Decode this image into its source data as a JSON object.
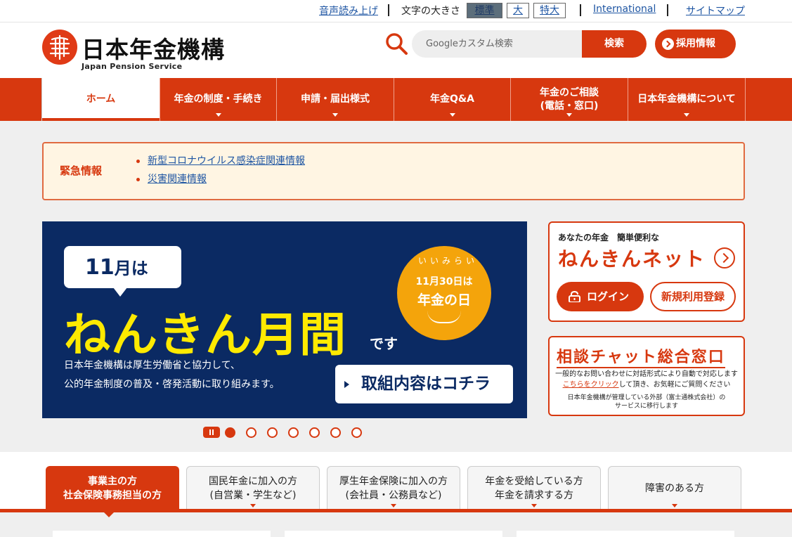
{
  "utility": {
    "voice": "音声読み上げ",
    "font_size_label": "文字の大きさ",
    "font_sizes": [
      "標準",
      "大",
      "特大"
    ],
    "international": "International",
    "sitemap": "サイトマップ"
  },
  "header": {
    "logo_text": "日本年金機構",
    "logo_sub": "Japan Pension Service",
    "search_placeholder": "Googleカスタム検索",
    "search_button": "検索",
    "recruit_button": "採用情報"
  },
  "nav": {
    "tabs": [
      {
        "label": "ホーム"
      },
      {
        "label": "年金の制度・手続き"
      },
      {
        "label": "申請・届出様式"
      },
      {
        "label": "年金Q&A"
      },
      {
        "label": "年金のご相談\n(電話・窓口)"
      },
      {
        "label": "日本年金機構について"
      }
    ]
  },
  "alert": {
    "title": "緊急情報",
    "items": [
      "新型コロナウイルス感染症関連情報",
      "災害関連情報"
    ]
  },
  "banner": {
    "bubble_num": "11",
    "bubble_rest": "月は",
    "headline": "ねんきん月間",
    "desu": "です",
    "desc": "日本年金機構は厚生労働省と協力して、\n公的年金制度の普及・啓発活動に取り組みます。",
    "cta": "取組内容はコチラ",
    "circle_arc": "いいみらい",
    "circle_line1": "11月30日は",
    "circle_line2": "年金の日"
  },
  "nenkin_net": {
    "sub": "あなたの年金　簡単便利な",
    "title": "ねんきんネット",
    "login": "ログイン",
    "register": "新規利用登録"
  },
  "chat": {
    "title": "相談チャット総合窓口",
    "desc1": "一般的なお問い合わせに対話形式により自動で対応します",
    "desc_link": "こちらをクリック",
    "desc2": "して頂き、お気軽にご質問ください",
    "note": "日本年金機構が管理している外部（富士通株式会社）の\nサービスに移行します"
  },
  "audience": {
    "tabs": [
      {
        "label": "事業主の方\n社会保険事務担当の方"
      },
      {
        "label": "国民年金に加入の方\n(自営業・学生など)"
      },
      {
        "label": "厚生年金保険に加入の方\n(会社員・公務員など)"
      },
      {
        "label": "年金を受給している方\n年金を請求する方"
      },
      {
        "label": "障害のある方"
      }
    ]
  },
  "colors": {
    "brand": "#d7380f",
    "banner_bg": "#0b2a63",
    "headline": "#ffea00",
    "alert_bg": "#fff5e3"
  }
}
